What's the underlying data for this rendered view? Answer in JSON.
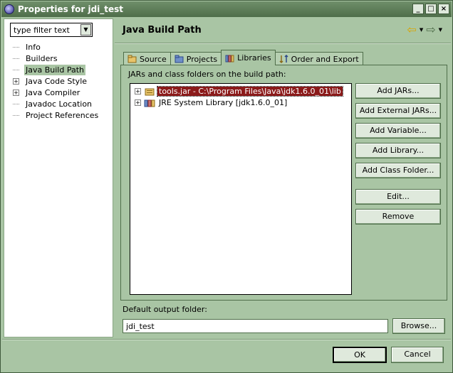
{
  "window": {
    "title": "Properties for jdi_test",
    "minimize": "_",
    "maximize": "□",
    "close": "×"
  },
  "filter": {
    "placeholder": "type filter text",
    "value": "type filter text"
  },
  "nav_tree": [
    {
      "label": "Info",
      "expandable": false,
      "selected": false
    },
    {
      "label": "Builders",
      "expandable": false,
      "selected": false
    },
    {
      "label": "Java Build Path",
      "expandable": false,
      "selected": true
    },
    {
      "label": "Java Code Style",
      "expandable": true,
      "selected": false
    },
    {
      "label": "Java Compiler",
      "expandable": true,
      "selected": false
    },
    {
      "label": "Javadoc Location",
      "expandable": false,
      "selected": false
    },
    {
      "label": "Project References",
      "expandable": false,
      "selected": false
    }
  ],
  "page": {
    "title": "Java Build Path"
  },
  "tabs": [
    {
      "label": "Source",
      "icon": "source-folder-icon"
    },
    {
      "label": "Projects",
      "icon": "projects-icon"
    },
    {
      "label": "Libraries",
      "icon": "libraries-icon",
      "active": true
    },
    {
      "label": "Order and Export",
      "icon": "order-export-icon"
    }
  ],
  "libraries": {
    "label": "JARs and class folders on the build path:",
    "items": [
      {
        "label": "tools.jar - C:\\Program Files\\Java\\jdk1.6.0_01\\lib",
        "selected": true
      },
      {
        "label": "JRE System Library [jdk1.6.0_01]",
        "selected": false
      }
    ]
  },
  "buttons": {
    "add_jars": "Add JARs...",
    "add_external_jars": "Add External JARs...",
    "add_variable": "Add Variable...",
    "add_library": "Add Library...",
    "add_class_folder": "Add Class Folder...",
    "edit": "Edit...",
    "remove": "Remove"
  },
  "output": {
    "label": "Default output folder:",
    "value": "jdi_test",
    "browse": "Browse..."
  },
  "dialog": {
    "ok": "OK",
    "cancel": "Cancel"
  },
  "colors": {
    "window_bg": "#a9c5a4",
    "selection": "#8b1a1a",
    "titlebar": "#4f6e4a"
  }
}
